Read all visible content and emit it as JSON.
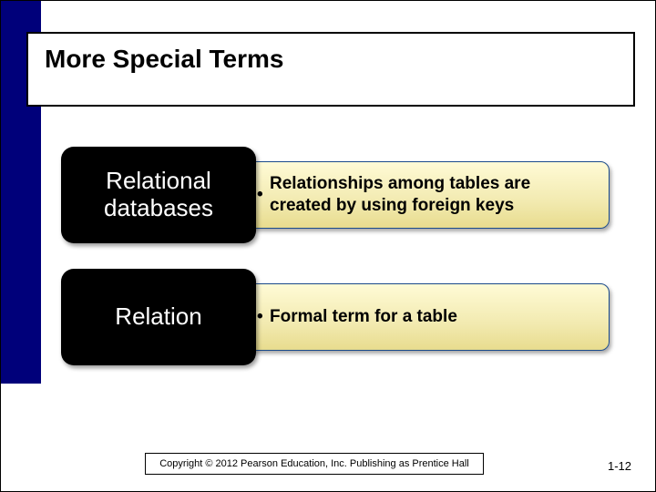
{
  "slide": {
    "title": "More Special Terms",
    "terms": [
      {
        "label": "Relational databases",
        "definition": "Relationships among tables are created by using foreign keys"
      },
      {
        "label": "Relation",
        "definition": "Formal term for a table"
      }
    ],
    "copyright": "Copyright © 2012 Pearson Education, Inc. Publishing as Prentice Hall",
    "page_number": "1-12"
  }
}
